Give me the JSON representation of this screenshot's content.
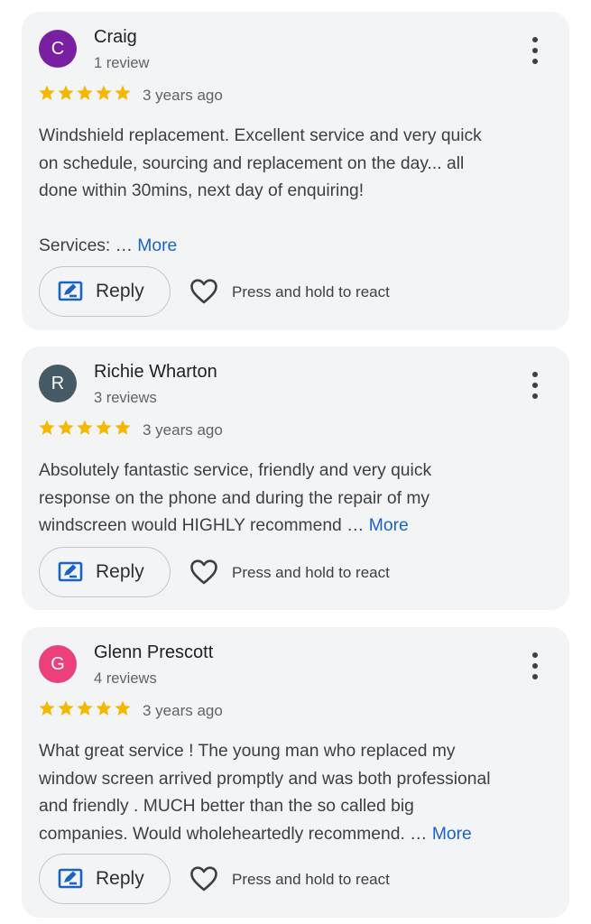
{
  "colors": {
    "star": "#f5b800",
    "link": "#1a62c6",
    "card_bg": "#f3f4f6"
  },
  "reviews": [
    {
      "initial": "C",
      "avatar_color": "#7b1fa2",
      "name": "Craig",
      "count": "1 review",
      "rating": 5,
      "time": "3 years ago",
      "text_lines": [
        "Windshield replacement. Excellent service and very quick",
        "on schedule, sourcing and replacement on the day... all",
        "done within 30mins, next day of enquiring!"
      ],
      "extra_line": "Services: …",
      "more": "More",
      "reply": "Reply",
      "react": "Press and hold to react",
      "menu_icon": "more-vert-icon"
    },
    {
      "initial": "R",
      "avatar_color": "#455a64",
      "name": "Richie Wharton",
      "count": "3 reviews",
      "rating": 5,
      "time": "3 years ago",
      "text_lines": [
        "Absolutely fantastic service, friendly and very quick",
        "response on the phone and during the repair of my",
        "windscreen would HIGHLY recommend …"
      ],
      "more": "More",
      "reply": "Reply",
      "react": "Press and hold to react",
      "menu_icon": "more-vert-icon"
    },
    {
      "initial": "G",
      "avatar_color": "#ec407a",
      "name": "Glenn Prescott",
      "count": "4 reviews",
      "rating": 5,
      "time": "3 years ago",
      "text_lines": [
        "What great service ! The young man who replaced my",
        "window screen arrived promptly and was both professional",
        "and friendly . MUCH better than the so called big",
        "companies. Would wholeheartedly recommend. …"
      ],
      "more": "More",
      "reply": "Reply",
      "react": "Press and hold to react",
      "menu_icon": "more-vert-icon"
    }
  ]
}
